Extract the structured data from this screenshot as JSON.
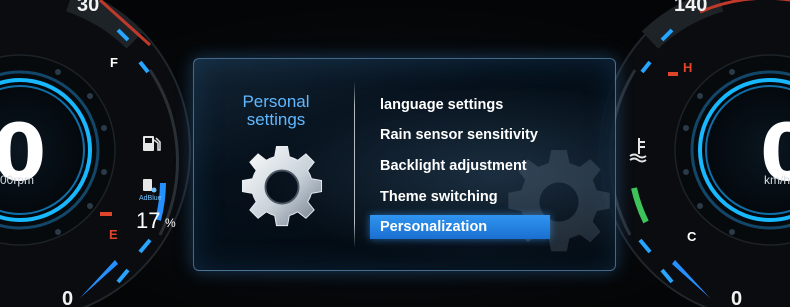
{
  "left_gauge": {
    "speed_value": "0",
    "unit_partial": "00rpm",
    "top_number": "30",
    "bottom_number": "0",
    "fuel_full_label": "F",
    "fuel_empty_label": "E",
    "adblue_label": "AdBlue",
    "adblue_percent": "17",
    "percent_symbol": "%",
    "icons": [
      "fuel-pump-icon",
      "adblue-icon"
    ]
  },
  "right_gauge": {
    "speed_value": "0",
    "unit_partial": "km/h",
    "top_number": "140",
    "bottom_number": "0",
    "temp_hot_label": "H",
    "temp_cold_label": "C",
    "icons": [
      "coolant-temperature-icon"
    ]
  },
  "menu_panel": {
    "title_line1": "Personal",
    "title_line2": "settings",
    "icon": "gear-icon",
    "items": [
      {
        "label": "language settings",
        "selected": false
      },
      {
        "label": "Rain sensor sensitivity",
        "selected": false
      },
      {
        "label": "Backlight adjustment",
        "selected": false
      },
      {
        "label": "Theme switching",
        "selected": false
      },
      {
        "label": "Personalization",
        "selected": true
      }
    ]
  },
  "colors": {
    "accent_blue": "#2a8ef0",
    "title_blue": "#5fb8ff",
    "warning_red": "#e0452a",
    "temp_green": "#3ec35a",
    "gauge_ring": "#18b8ff"
  }
}
